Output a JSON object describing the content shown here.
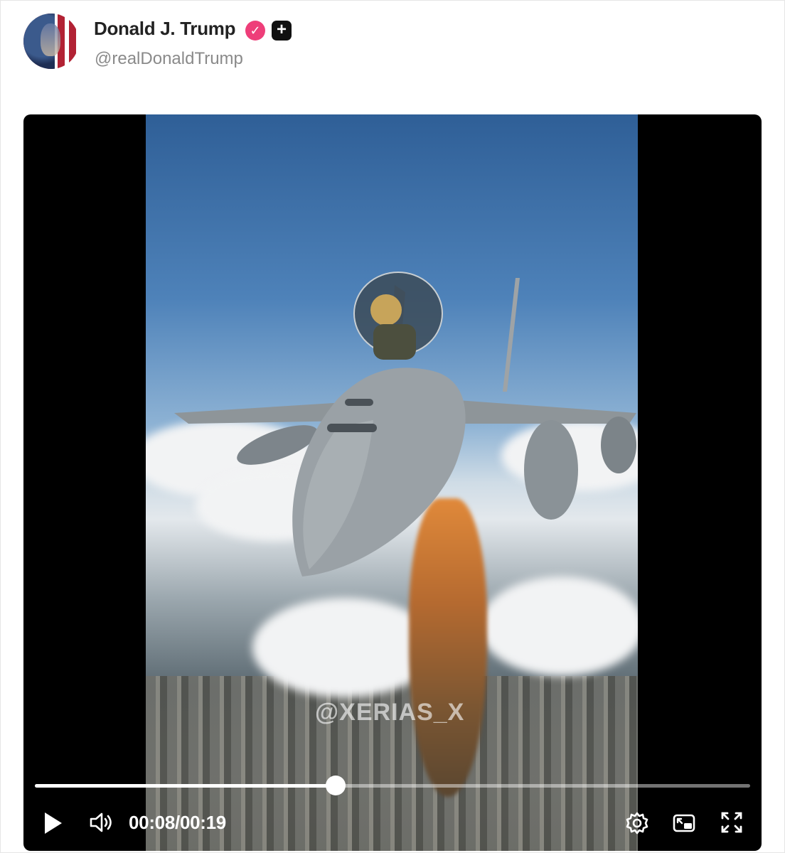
{
  "post": {
    "author_name": "Donald J. Trump",
    "author_handle": "@realDonaldTrump",
    "verified_icon": "check-badge-icon",
    "plus_icon": "plus-square-icon"
  },
  "video": {
    "watermark": "@XERIAS_X",
    "current_time": "00:08",
    "separator": "/",
    "duration": "00:19",
    "progress_fraction": 0.42,
    "controls": {
      "play": "play-icon",
      "volume": "volume-icon",
      "settings": "gear-icon",
      "pip": "picture-in-picture-icon",
      "fullscreen": "fullscreen-icon"
    }
  },
  "colors": {
    "verified_badge": "#ee3e79",
    "name_text": "#222222",
    "handle_text": "#8a8a8a",
    "video_bg": "#000000"
  }
}
